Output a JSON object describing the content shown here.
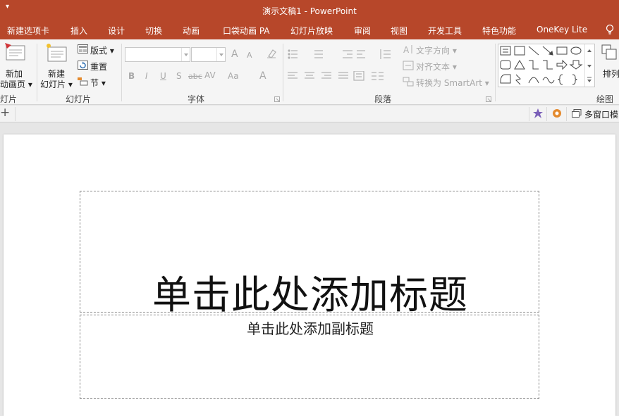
{
  "window": {
    "title": "演示文稿1 - PowerPoint",
    "qat_glyph": "▾"
  },
  "tabs": [
    {
      "label": "新建选项卡"
    },
    {
      "label": "插入"
    },
    {
      "label": "设计"
    },
    {
      "label": "切换"
    },
    {
      "label": "动画"
    },
    {
      "label": "口袋动画 PA"
    },
    {
      "label": "幻灯片放映"
    },
    {
      "label": "审阅"
    },
    {
      "label": "视图"
    },
    {
      "label": "开发工具"
    },
    {
      "label": "特色功能"
    },
    {
      "label": "OneKey Lite"
    }
  ],
  "ribbon": {
    "add_anim_page": {
      "line1": "新加",
      "line2": "动画页 ▾"
    },
    "group1_label": "灯片",
    "new_slide": {
      "line1": "新建",
      "line2": "幻灯片 ▾"
    },
    "layout": "版式 ▾",
    "reset": "重置",
    "section": "节 ▾",
    "group2_label": "幻灯片",
    "font_buttons": {
      "bold": "B",
      "italic": "I",
      "underline": "U",
      "shadow": "S",
      "strike": "abc",
      "spacing": "AV",
      "case": "Aa",
      "color": "A"
    },
    "font_size_up": "A",
    "font_size_down": "A",
    "group3_label": "字体",
    "text_direction": "文字方向 ▾",
    "align_text": "对齐文本 ▾",
    "smartart": "转换为 SmartArt ▾",
    "group4_label": "段落",
    "arrange": "排列",
    "group5_label": "绘图"
  },
  "qbar": {
    "add": "+",
    "multiwindow": "多窗口模"
  },
  "slide": {
    "title_placeholder": "单击此处添加标题",
    "subtitle_placeholder": "单击此处添加副标题"
  },
  "colors": {
    "accent": "#b7472a",
    "ribbon_bg": "#f5f5f5",
    "canvas_bg": "#e6e6e6"
  }
}
